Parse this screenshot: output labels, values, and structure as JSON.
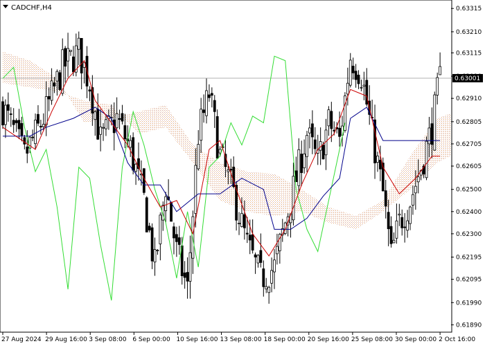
{
  "chart": {
    "symbol_label": "CADCHF,H4",
    "current_price_label": "0.63001",
    "colors": {
      "background": "#ffffff",
      "bull_candle": "#000000",
      "bear_candle": "#000000",
      "tenkan": "#cc0000",
      "kijun": "#00008b",
      "chikou": "#33dd33",
      "cloud_a": "#d9b2b2",
      "cloud_b": "#e8b07a",
      "price_line": "#b0b0b0",
      "price_tag_bg": "#000000"
    }
  },
  "chart_data": {
    "type": "candlestick",
    "indicator": "ichimoku",
    "ylim": [
      0.6186,
      0.6335
    ],
    "y_ticks": [
      "0.63315",
      "0.63210",
      "0.63115",
      "0.63010",
      "0.62910",
      "0.62805",
      "0.62705",
      "0.62605",
      "0.62500",
      "0.62400",
      "0.62300",
      "0.62195",
      "0.62095",
      "0.61990",
      "0.61890"
    ],
    "x_ticks": [
      "27 Aug 2024",
      "29 Aug 16:00",
      "3 Sep 08:00",
      "6 Sep 00:00",
      "10 Sep 16:00",
      "13 Sep 08:00",
      "18 Sep 00:00",
      "20 Sep 16:00",
      "25 Sep 08:00",
      "30 Sep 00:00",
      "2 Oct 16:00"
    ],
    "current_price": 0.63001,
    "close_path": [
      {
        "t": 0,
        "c": 0.6287
      },
      {
        "t": 8,
        "c": 0.6265
      },
      {
        "t": 15,
        "c": 0.6282
      },
      {
        "t": 22,
        "c": 0.6305
      },
      {
        "t": 28,
        "c": 0.6312
      },
      {
        "t": 32,
        "c": 0.6298
      },
      {
        "t": 36,
        "c": 0.6272
      },
      {
        "t": 42,
        "c": 0.6282
      },
      {
        "t": 47,
        "c": 0.6268
      },
      {
        "t": 52,
        "c": 0.6245
      },
      {
        "t": 56,
        "c": 0.6215
      },
      {
        "t": 60,
        "c": 0.6252
      },
      {
        "t": 64,
        "c": 0.6222
      },
      {
        "t": 68,
        "c": 0.6205
      },
      {
        "t": 72,
        "c": 0.6275
      },
      {
        "t": 76,
        "c": 0.6293
      },
      {
        "t": 80,
        "c": 0.6265
      },
      {
        "t": 85,
        "c": 0.6248
      },
      {
        "t": 90,
        "c": 0.6225
      },
      {
        "t": 95,
        "c": 0.621
      },
      {
        "t": 100,
        "c": 0.6215
      },
      {
        "t": 104,
        "c": 0.6235
      },
      {
        "t": 108,
        "c": 0.6255
      },
      {
        "t": 112,
        "c": 0.6275
      },
      {
        "t": 116,
        "c": 0.6262
      },
      {
        "t": 120,
        "c": 0.628
      },
      {
        "t": 124,
        "c": 0.6272
      },
      {
        "t": 128,
        "c": 0.631
      },
      {
        "t": 132,
        "c": 0.6302
      },
      {
        "t": 136,
        "c": 0.6275
      },
      {
        "t": 140,
        "c": 0.6248
      },
      {
        "t": 143,
        "c": 0.622
      },
      {
        "t": 146,
        "c": 0.6235
      },
      {
        "t": 150,
        "c": 0.6245
      },
      {
        "t": 154,
        "c": 0.626
      },
      {
        "t": 158,
        "c": 0.6278
      },
      {
        "t": 161,
        "c": 0.63
      }
    ],
    "tenkan": [
      {
        "t": 0,
        "v": 0.6278
      },
      {
        "t": 12,
        "v": 0.6268
      },
      {
        "t": 18,
        "v": 0.6285
      },
      {
        "t": 24,
        "v": 0.63
      },
      {
        "t": 30,
        "v": 0.6308
      },
      {
        "t": 34,
        "v": 0.629
      },
      {
        "t": 40,
        "v": 0.628
      },
      {
        "t": 46,
        "v": 0.627
      },
      {
        "t": 52,
        "v": 0.6255
      },
      {
        "t": 58,
        "v": 0.6242
      },
      {
        "t": 64,
        "v": 0.6245
      },
      {
        "t": 70,
        "v": 0.623
      },
      {
        "t": 76,
        "v": 0.6268
      },
      {
        "t": 80,
        "v": 0.6272
      },
      {
        "t": 86,
        "v": 0.625
      },
      {
        "t": 92,
        "v": 0.623
      },
      {
        "t": 98,
        "v": 0.622
      },
      {
        "t": 104,
        "v": 0.6232
      },
      {
        "t": 110,
        "v": 0.6252
      },
      {
        "t": 116,
        "v": 0.6268
      },
      {
        "t": 122,
        "v": 0.6275
      },
      {
        "t": 128,
        "v": 0.6295
      },
      {
        "t": 134,
        "v": 0.6292
      },
      {
        "t": 140,
        "v": 0.626
      },
      {
        "t": 146,
        "v": 0.6248
      },
      {
        "t": 152,
        "v": 0.6255
      },
      {
        "t": 158,
        "v": 0.6265
      },
      {
        "t": 161,
        "v": 0.6265
      }
    ],
    "kijun": [
      {
        "t": 0,
        "v": 0.6274
      },
      {
        "t": 10,
        "v": 0.6274
      },
      {
        "t": 16,
        "v": 0.6278
      },
      {
        "t": 26,
        "v": 0.6282
      },
      {
        "t": 34,
        "v": 0.6287
      },
      {
        "t": 40,
        "v": 0.6282
      },
      {
        "t": 46,
        "v": 0.6262
      },
      {
        "t": 52,
        "v": 0.6252
      },
      {
        "t": 58,
        "v": 0.6252
      },
      {
        "t": 64,
        "v": 0.624
      },
      {
        "t": 72,
        "v": 0.6248
      },
      {
        "t": 80,
        "v": 0.6248
      },
      {
        "t": 88,
        "v": 0.6255
      },
      {
        "t": 96,
        "v": 0.625
      },
      {
        "t": 100,
        "v": 0.6232
      },
      {
        "t": 106,
        "v": 0.6232
      },
      {
        "t": 112,
        "v": 0.6237
      },
      {
        "t": 118,
        "v": 0.6247
      },
      {
        "t": 124,
        "v": 0.6255
      },
      {
        "t": 128,
        "v": 0.6282
      },
      {
        "t": 134,
        "v": 0.6287
      },
      {
        "t": 140,
        "v": 0.6272
      },
      {
        "t": 148,
        "v": 0.6272
      },
      {
        "t": 155,
        "v": 0.6272
      },
      {
        "t": 161,
        "v": 0.6272
      }
    ],
    "chikou": [
      {
        "t": 0,
        "v": 0.63
      },
      {
        "t": 4,
        "v": 0.6305
      },
      {
        "t": 8,
        "v": 0.6278
      },
      {
        "t": 12,
        "v": 0.6258
      },
      {
        "t": 16,
        "v": 0.6268
      },
      {
        "t": 20,
        "v": 0.6242
      },
      {
        "t": 24,
        "v": 0.6205
      },
      {
        "t": 28,
        "v": 0.626
      },
      {
        "t": 32,
        "v": 0.6255
      },
      {
        "t": 36,
        "v": 0.6225
      },
      {
        "t": 40,
        "v": 0.62
      },
      {
        "t": 44,
        "v": 0.626
      },
      {
        "t": 48,
        "v": 0.6285
      },
      {
        "t": 52,
        "v": 0.627
      },
      {
        "t": 56,
        "v": 0.625
      },
      {
        "t": 60,
        "v": 0.6235
      },
      {
        "t": 64,
        "v": 0.621
      },
      {
        "t": 68,
        "v": 0.624
      },
      {
        "t": 72,
        "v": 0.6215
      },
      {
        "t": 76,
        "v": 0.626
      },
      {
        "t": 80,
        "v": 0.6265
      },
      {
        "t": 84,
        "v": 0.628
      },
      {
        "t": 88,
        "v": 0.627
      },
      {
        "t": 92,
        "v": 0.6283
      },
      {
        "t": 96,
        "v": 0.628
      },
      {
        "t": 100,
        "v": 0.631
      },
      {
        "t": 104,
        "v": 0.6308
      },
      {
        "t": 108,
        "v": 0.625
      },
      {
        "t": 112,
        "v": 0.6232
      },
      {
        "t": 116,
        "v": 0.6222
      },
      {
        "t": 120,
        "v": 0.6245
      },
      {
        "t": 124,
        "v": 0.6268
      },
      {
        "t": 126,
        "v": 0.628
      }
    ],
    "span_a": [
      {
        "t": 0,
        "v": 0.6312
      },
      {
        "t": 10,
        "v": 0.6308
      },
      {
        "t": 20,
        "v": 0.63
      },
      {
        "t": 30,
        "v": 0.628
      },
      {
        "t": 40,
        "v": 0.6282
      },
      {
        "t": 50,
        "v": 0.6285
      },
      {
        "t": 60,
        "v": 0.6288
      },
      {
        "t": 70,
        "v": 0.627
      },
      {
        "t": 80,
        "v": 0.6262
      },
      {
        "t": 90,
        "v": 0.6258
      },
      {
        "t": 100,
        "v": 0.6257
      },
      {
        "t": 110,
        "v": 0.625
      },
      {
        "t": 120,
        "v": 0.6242
      },
      {
        "t": 130,
        "v": 0.6238
      },
      {
        "t": 140,
        "v": 0.6245
      },
      {
        "t": 150,
        "v": 0.6265
      },
      {
        "t": 160,
        "v": 0.6282
      },
      {
        "t": 173,
        "v": 0.6288
      }
    ],
    "span_b": [
      {
        "t": 0,
        "v": 0.6298
      },
      {
        "t": 10,
        "v": 0.6296
      },
      {
        "t": 20,
        "v": 0.6294
      },
      {
        "t": 30,
        "v": 0.629
      },
      {
        "t": 40,
        "v": 0.6288
      },
      {
        "t": 50,
        "v": 0.6275
      },
      {
        "t": 60,
        "v": 0.6278
      },
      {
        "t": 70,
        "v": 0.6262
      },
      {
        "t": 80,
        "v": 0.6245
      },
      {
        "t": 90,
        "v": 0.624
      },
      {
        "t": 100,
        "v": 0.6238
      },
      {
        "t": 110,
        "v": 0.624
      },
      {
        "t": 120,
        "v": 0.6235
      },
      {
        "t": 130,
        "v": 0.6232
      },
      {
        "t": 140,
        "v": 0.624
      },
      {
        "t": 150,
        "v": 0.625
      },
      {
        "t": 160,
        "v": 0.6262
      },
      {
        "t": 173,
        "v": 0.627
      }
    ]
  }
}
